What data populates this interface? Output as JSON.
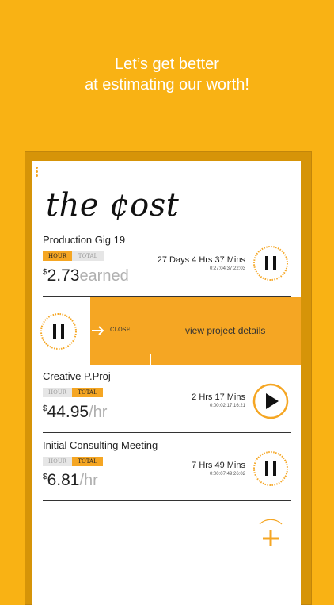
{
  "tagline": {
    "line1": "Let’s get better",
    "line2": "at estimating our worth!"
  },
  "app": {
    "title": "the ¢ost"
  },
  "projects": [
    {
      "name": "Production Gig 19",
      "tags": {
        "hour": "HOUR",
        "total": "TOTAL",
        "active": "hour"
      },
      "currency": "$",
      "amount": "2.73",
      "unit": "earned",
      "duration": "27 Days 4 Hrs 37 Mins",
      "duration_detail": "0:27:04:37:22:03",
      "state": "pause"
    },
    {
      "name": "Creative P.Proj",
      "tags": {
        "hour": "HOUR",
        "total": "TOTAL",
        "active": "total"
      },
      "currency": "$",
      "amount": "44.95",
      "unit": "/hr",
      "duration": "2 Hrs 17 Mins",
      "duration_detail": "0:00:02:17:16:21",
      "state": "play"
    },
    {
      "name": "Initial Consulting Meeting",
      "tags": {
        "hour": "HOUR",
        "total": "TOTAL",
        "active": "total"
      },
      "currency": "$",
      "amount": "6.81",
      "unit": "/hr",
      "duration": "7 Hrs 49 Mins",
      "duration_detail": "0:00:07:49:26:02",
      "state": "pause"
    }
  ],
  "swipe_actions": {
    "close": "CLOSE",
    "view": "view project details"
  },
  "icons": {
    "menu": "more-vertical-icon",
    "pause": "pause-icon",
    "play": "play-icon",
    "add": "plus-icon",
    "arrow": "arrow-right-icon"
  },
  "colors": {
    "accent": "#F5A623",
    "background": "#F9B214",
    "frame": "#D69408"
  }
}
